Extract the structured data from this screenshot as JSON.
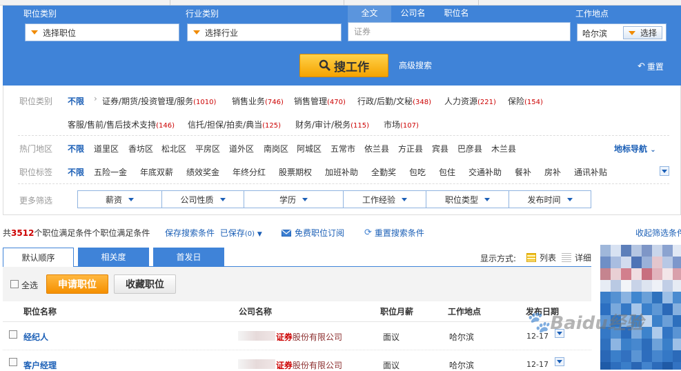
{
  "search": {
    "job_category_label": "职位类别",
    "job_category_value": "选择职位",
    "industry_label": "行业类别",
    "industry_value": "选择行业",
    "scope_tabs": [
      "全文",
      "公司名",
      "职位名"
    ],
    "keyword_value": "证券",
    "location_label": "工作地点",
    "location_value": "哈尔滨",
    "location_button": "选择",
    "search_button": "搜工作",
    "advanced": "高级搜索",
    "reset": "重置"
  },
  "filters": {
    "category_label": "职位类别",
    "unlimited": "不限",
    "categories_row1": [
      {
        "name": "证券/期货/投资管理/服务",
        "count": "(1010)"
      },
      {
        "name": "销售业务",
        "count": "(746)"
      },
      {
        "name": "销售管理",
        "count": "(470)"
      },
      {
        "name": "行政/后勤/文秘",
        "count": "(348)"
      },
      {
        "name": "人力资源",
        "count": "(221)"
      },
      {
        "name": "保险",
        "count": "(154)"
      }
    ],
    "categories_row2": [
      {
        "name": "客服/售前/售后技术支持",
        "count": "(146)"
      },
      {
        "name": "信托/担保/拍卖/典当",
        "count": "(125)"
      },
      {
        "name": "财务/审计/税务",
        "count": "(115)"
      },
      {
        "name": "市场",
        "count": "(107)"
      }
    ],
    "area_label": "热门地区",
    "areas": [
      "道里区",
      "香坊区",
      "松北区",
      "平房区",
      "道外区",
      "南岗区",
      "阿城区",
      "五常市",
      "依兰县",
      "方正县",
      "宾县",
      "巴彦县",
      "木兰县"
    ],
    "landmark_nav": "地标导航",
    "tag_label": "职位标签",
    "tags": [
      "五险一金",
      "年底双薪",
      "绩效奖金",
      "年终分红",
      "股票期权",
      "加班补助",
      "全勤奖",
      "包吃",
      "包住",
      "交通补助",
      "餐补",
      "房补",
      "通讯补贴"
    ],
    "more_label": "更多筛选",
    "more_dropdowns": [
      "薪资",
      "公司性质",
      "学历",
      "工作经验",
      "职位类型",
      "发布时间"
    ]
  },
  "results": {
    "prefix": "共",
    "count": "3512",
    "suffix": "个职位满足条件个职位满足条件",
    "save_search": "保存搜索条件",
    "saved": "已保存",
    "saved_count": "(0)",
    "subscribe": "免费职位订阅",
    "reset_search": "重置搜索条件",
    "collapse": "收起筛选条件"
  },
  "sort_tabs": [
    "默认顺序",
    "相关度",
    "首发日"
  ],
  "display": {
    "label": "显示方式:",
    "list": "列表",
    "detail": "详细"
  },
  "actions": {
    "select_all": "全选",
    "apply": "申请职位",
    "favorite": "收藏职位"
  },
  "table": {
    "headers": [
      "职位名称",
      "公司名称",
      "职位月薪",
      "工作地点",
      "发布日期"
    ],
    "rows": [
      {
        "title": "经纪人",
        "company_highlight": "证券",
        "company_rest": "股份有限公司",
        "salary": "面议",
        "location": "哈尔滨",
        "date": "12-17"
      },
      {
        "title": "客户经理",
        "company_highlight": "证券",
        "company_rest": "股份有限公司",
        "salary": "面议",
        "location": "哈尔滨",
        "date": "12-17"
      }
    ]
  },
  "watermark": "Baidu经验",
  "colors": {
    "banner": "#3f83d8",
    "link": "#1b5fb6",
    "count_red": "#c00000",
    "orange": "#f5a300"
  }
}
